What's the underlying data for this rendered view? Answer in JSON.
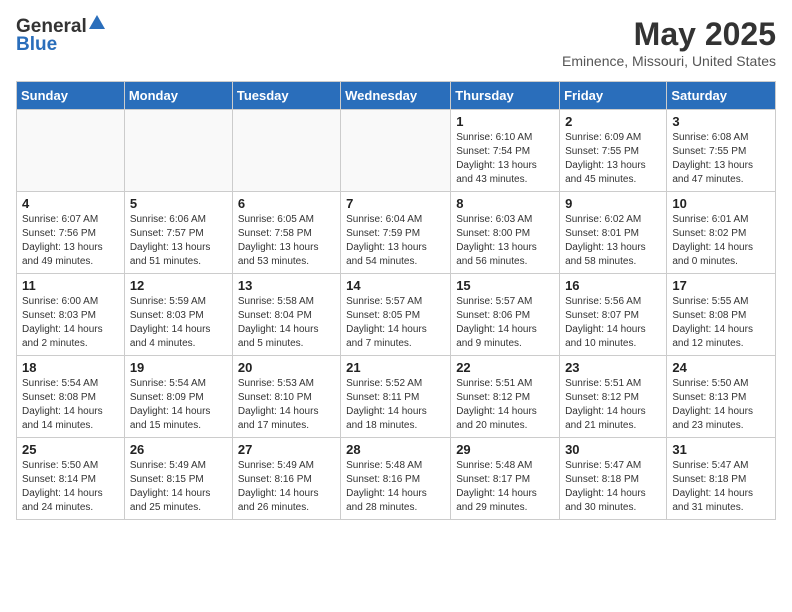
{
  "header": {
    "logo_general": "General",
    "logo_blue": "Blue",
    "title": "May 2025",
    "subtitle": "Eminence, Missouri, United States"
  },
  "days_of_week": [
    "Sunday",
    "Monday",
    "Tuesday",
    "Wednesday",
    "Thursday",
    "Friday",
    "Saturday"
  ],
  "weeks": [
    [
      {
        "day": "",
        "info": ""
      },
      {
        "day": "",
        "info": ""
      },
      {
        "day": "",
        "info": ""
      },
      {
        "day": "",
        "info": ""
      },
      {
        "day": "1",
        "info": "Sunrise: 6:10 AM\nSunset: 7:54 PM\nDaylight: 13 hours\nand 43 minutes."
      },
      {
        "day": "2",
        "info": "Sunrise: 6:09 AM\nSunset: 7:55 PM\nDaylight: 13 hours\nand 45 minutes."
      },
      {
        "day": "3",
        "info": "Sunrise: 6:08 AM\nSunset: 7:55 PM\nDaylight: 13 hours\nand 47 minutes."
      }
    ],
    [
      {
        "day": "4",
        "info": "Sunrise: 6:07 AM\nSunset: 7:56 PM\nDaylight: 13 hours\nand 49 minutes."
      },
      {
        "day": "5",
        "info": "Sunrise: 6:06 AM\nSunset: 7:57 PM\nDaylight: 13 hours\nand 51 minutes."
      },
      {
        "day": "6",
        "info": "Sunrise: 6:05 AM\nSunset: 7:58 PM\nDaylight: 13 hours\nand 53 minutes."
      },
      {
        "day": "7",
        "info": "Sunrise: 6:04 AM\nSunset: 7:59 PM\nDaylight: 13 hours\nand 54 minutes."
      },
      {
        "day": "8",
        "info": "Sunrise: 6:03 AM\nSunset: 8:00 PM\nDaylight: 13 hours\nand 56 minutes."
      },
      {
        "day": "9",
        "info": "Sunrise: 6:02 AM\nSunset: 8:01 PM\nDaylight: 13 hours\nand 58 minutes."
      },
      {
        "day": "10",
        "info": "Sunrise: 6:01 AM\nSunset: 8:02 PM\nDaylight: 14 hours\nand 0 minutes."
      }
    ],
    [
      {
        "day": "11",
        "info": "Sunrise: 6:00 AM\nSunset: 8:03 PM\nDaylight: 14 hours\nand 2 minutes."
      },
      {
        "day": "12",
        "info": "Sunrise: 5:59 AM\nSunset: 8:03 PM\nDaylight: 14 hours\nand 4 minutes."
      },
      {
        "day": "13",
        "info": "Sunrise: 5:58 AM\nSunset: 8:04 PM\nDaylight: 14 hours\nand 5 minutes."
      },
      {
        "day": "14",
        "info": "Sunrise: 5:57 AM\nSunset: 8:05 PM\nDaylight: 14 hours\nand 7 minutes."
      },
      {
        "day": "15",
        "info": "Sunrise: 5:57 AM\nSunset: 8:06 PM\nDaylight: 14 hours\nand 9 minutes."
      },
      {
        "day": "16",
        "info": "Sunrise: 5:56 AM\nSunset: 8:07 PM\nDaylight: 14 hours\nand 10 minutes."
      },
      {
        "day": "17",
        "info": "Sunrise: 5:55 AM\nSunset: 8:08 PM\nDaylight: 14 hours\nand 12 minutes."
      }
    ],
    [
      {
        "day": "18",
        "info": "Sunrise: 5:54 AM\nSunset: 8:08 PM\nDaylight: 14 hours\nand 14 minutes."
      },
      {
        "day": "19",
        "info": "Sunrise: 5:54 AM\nSunset: 8:09 PM\nDaylight: 14 hours\nand 15 minutes."
      },
      {
        "day": "20",
        "info": "Sunrise: 5:53 AM\nSunset: 8:10 PM\nDaylight: 14 hours\nand 17 minutes."
      },
      {
        "day": "21",
        "info": "Sunrise: 5:52 AM\nSunset: 8:11 PM\nDaylight: 14 hours\nand 18 minutes."
      },
      {
        "day": "22",
        "info": "Sunrise: 5:51 AM\nSunset: 8:12 PM\nDaylight: 14 hours\nand 20 minutes."
      },
      {
        "day": "23",
        "info": "Sunrise: 5:51 AM\nSunset: 8:12 PM\nDaylight: 14 hours\nand 21 minutes."
      },
      {
        "day": "24",
        "info": "Sunrise: 5:50 AM\nSunset: 8:13 PM\nDaylight: 14 hours\nand 23 minutes."
      }
    ],
    [
      {
        "day": "25",
        "info": "Sunrise: 5:50 AM\nSunset: 8:14 PM\nDaylight: 14 hours\nand 24 minutes."
      },
      {
        "day": "26",
        "info": "Sunrise: 5:49 AM\nSunset: 8:15 PM\nDaylight: 14 hours\nand 25 minutes."
      },
      {
        "day": "27",
        "info": "Sunrise: 5:49 AM\nSunset: 8:16 PM\nDaylight: 14 hours\nand 26 minutes."
      },
      {
        "day": "28",
        "info": "Sunrise: 5:48 AM\nSunset: 8:16 PM\nDaylight: 14 hours\nand 28 minutes."
      },
      {
        "day": "29",
        "info": "Sunrise: 5:48 AM\nSunset: 8:17 PM\nDaylight: 14 hours\nand 29 minutes."
      },
      {
        "day": "30",
        "info": "Sunrise: 5:47 AM\nSunset: 8:18 PM\nDaylight: 14 hours\nand 30 minutes."
      },
      {
        "day": "31",
        "info": "Sunrise: 5:47 AM\nSunset: 8:18 PM\nDaylight: 14 hours\nand 31 minutes."
      }
    ]
  ]
}
